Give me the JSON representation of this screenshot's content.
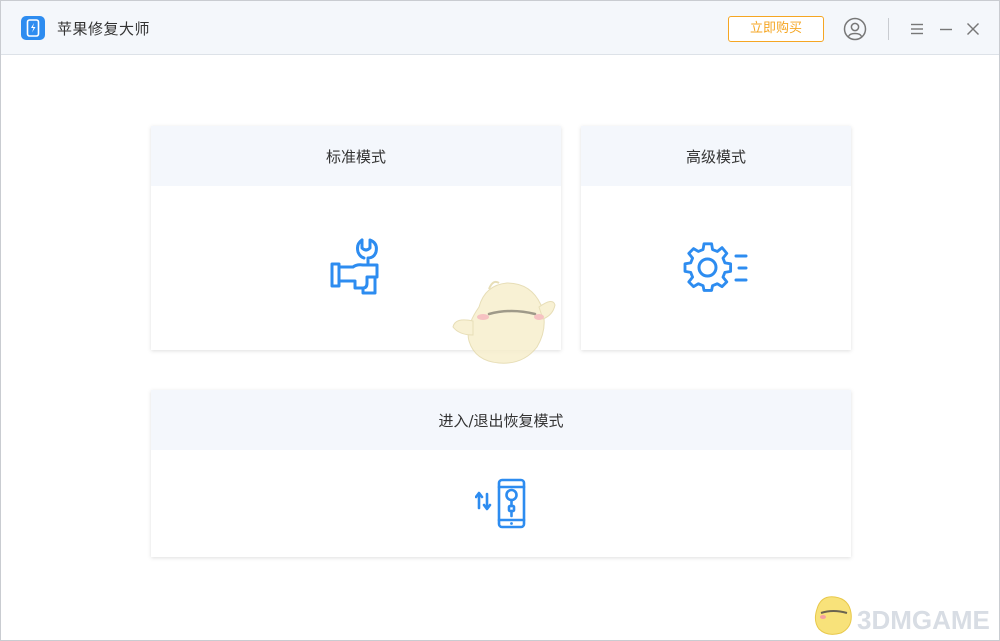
{
  "window": {
    "app_title": "苹果修复大师",
    "buy_label": "立即购买"
  },
  "icons": {
    "logo": "phone-logo-icon",
    "user": "user-icon",
    "menu": "menu-icon",
    "minimize": "minimize-icon",
    "close": "close-icon",
    "standard": "wrench-hand-icon",
    "advanced": "gear-settings-icon",
    "recovery": "phone-recovery-icon"
  },
  "modes": {
    "standard": {
      "label": "标准模式"
    },
    "advanced": {
      "label": "高级模式"
    },
    "recovery": {
      "label": "进入/退出恢复模式"
    }
  },
  "watermark": {
    "text": "3DMGAME"
  },
  "colors": {
    "accent": "#2d8cf0",
    "buy": "#f5a623",
    "header_bg": "#f4f7fc"
  }
}
